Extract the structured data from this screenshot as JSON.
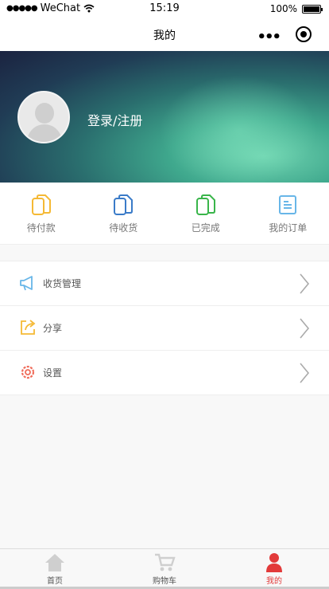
{
  "status_bar": {
    "carrier": "WeChat",
    "time": "15:19",
    "battery": "100%"
  },
  "nav": {
    "title": "我的"
  },
  "profile": {
    "login_label": "登录/注册"
  },
  "orders": [
    {
      "label": "待付款",
      "icon": "pending-payment-icon",
      "color": "#f5b935"
    },
    {
      "label": "待收货",
      "icon": "pending-receipt-icon",
      "color": "#3a7bc8"
    },
    {
      "label": "已完成",
      "icon": "completed-icon",
      "color": "#39b54a"
    },
    {
      "label": "我的订单",
      "icon": "my-orders-icon",
      "color": "#68b6e8"
    }
  ],
  "menu": [
    {
      "label": "收货管理",
      "icon": "megaphone-icon",
      "color": "#68b6e8"
    },
    {
      "label": "分享",
      "icon": "share-icon",
      "color": "#f5b935"
    },
    {
      "label": "设置",
      "icon": "settings-icon",
      "color": "#f06c5a"
    }
  ],
  "tabs": [
    {
      "label": "首页",
      "icon": "home-icon",
      "active": false
    },
    {
      "label": "购物车",
      "icon": "cart-icon",
      "active": false
    },
    {
      "label": "我的",
      "icon": "profile-icon",
      "active": true
    }
  ],
  "colors": {
    "accent": "#e23a3a",
    "tab_inactive": "#cfcfcf"
  }
}
